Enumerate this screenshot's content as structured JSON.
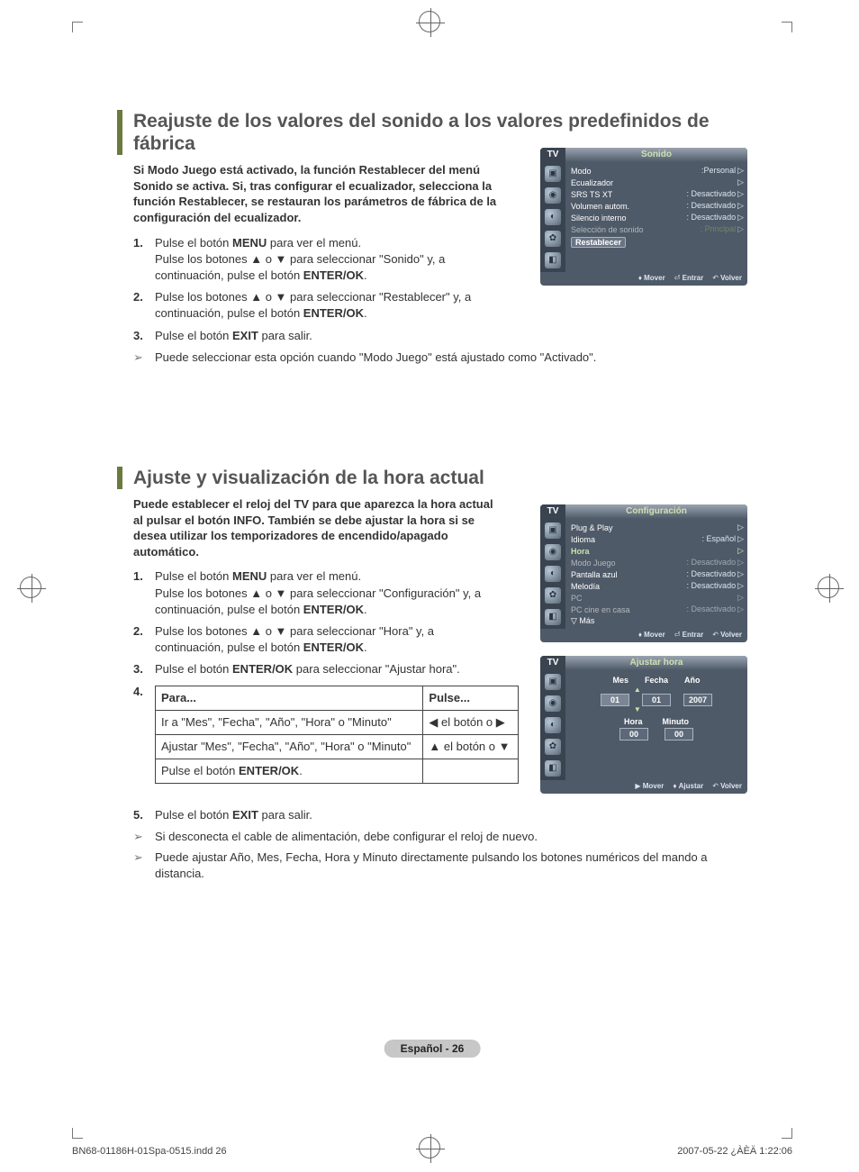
{
  "section1": {
    "title": "Reajuste de los valores del sonido a los valores predefinidos de fábrica",
    "intro": "Si Modo Juego está activado, la función Restablecer del menú Sonido se activa. Si, tras configurar el ecualizador, selecciona la función Restablecer, se restauran los parámetros de fábrica de la configuración del ecualizador.",
    "steps": [
      "Pulse el botón MENU para ver el menú.\nPulse los botones ▲ o ▼ para seleccionar \"Sonido\" y, a continuación, pulse el botón ENTER/OK.",
      "Pulse los botones ▲ o ▼ para seleccionar \"Restablecer\" y, a continuación, pulse el botón ENTER/OK.",
      "Pulse el botón EXIT para salir."
    ],
    "note": "Puede seleccionar esta opción cuando \"Modo Juego\" está ajustado como \"Activado\"."
  },
  "osd1": {
    "tv": "TV",
    "title": "Sonido",
    "rows": [
      {
        "lbl": "Modo",
        "val": ":Personal",
        "tri": "▷"
      },
      {
        "lbl": "Ecualizador",
        "val": "",
        "tri": "▷"
      },
      {
        "lbl": "SRS TS XT",
        "val": ": Desactivado",
        "tri": "▷"
      },
      {
        "lbl": "Volumen autom.",
        "val": ": Desactivado",
        "tri": "▷"
      },
      {
        "lbl": "Silencio interno",
        "val": ": Desactivado",
        "tri": "▷"
      },
      {
        "lbl": "Selección de sonido",
        "val": ": Principal",
        "tri": "▷",
        "dim": true
      }
    ],
    "pill": "Restablecer",
    "foot": {
      "move": "Mover",
      "enter": "Entrar",
      "back": "Volver"
    }
  },
  "section2": {
    "title": "Ajuste y visualización de la hora actual",
    "intro": "Puede establecer el reloj del TV para que aparezca la hora actual al pulsar el botón INFO. También se debe ajustar la hora si se desea utilizar los temporizadores de encendido/apagado automático.",
    "steps": [
      "Pulse el botón MENU para ver el menú.\nPulse los botones ▲ o ▼ para seleccionar \"Configuración\" y, a continuación, pulse el botón ENTER/OK.",
      "Pulse los botones ▲ o ▼ para seleccionar \"Hora\" y, a continuación, pulse el botón ENTER/OK.",
      "Pulse el botón ENTER/OK para seleccionar \"Ajustar hora\"."
    ],
    "step4": "4.",
    "table": {
      "h1": "Para...",
      "h2": "Pulse...",
      "rows": [
        {
          "a": "Ir a \"Mes\", \"Fecha\", \"Año\", \"Hora\" o \"Minuto\"",
          "b": "◀ el botón  o ▶"
        },
        {
          "a": "Ajustar \"Mes\", \"Fecha\", \"Año\", \"Hora\" o \"Minuto\"",
          "b": "▲ el botón  o ▼"
        },
        {
          "a": "Pulse el botón ENTER/OK.",
          "b": ""
        }
      ]
    },
    "step5": "Pulse el botón EXIT para salir.",
    "note1": "Si desconecta el cable de alimentación, debe configurar el reloj de nuevo.",
    "note2": "Puede ajustar Año, Mes, Fecha, Hora y Minuto directamente pulsando los botones numéricos del mando a distancia."
  },
  "osd2": {
    "tv": "TV",
    "title": "Configuración",
    "rows": [
      {
        "lbl": "Plug & Play",
        "val": "",
        "tri": "▷"
      },
      {
        "lbl": "Idioma",
        "val": ": Español",
        "tri": "▷"
      },
      {
        "lbl": "Hora",
        "val": "",
        "tri": "▷",
        "sel": true
      },
      {
        "lbl": "Modo Juego",
        "val": ": Desactivado",
        "tri": "▷",
        "dim": true
      },
      {
        "lbl": "Pantalla azul",
        "val": ": Desactivado",
        "tri": "▷"
      },
      {
        "lbl": "Melodía",
        "val": ": Desactivado",
        "tri": "▷"
      },
      {
        "lbl": "PC",
        "val": "",
        "tri": "▷",
        "dim": true
      },
      {
        "lbl": "PC cine en casa",
        "val": ": Desactivado",
        "tri": "▷",
        "dim": true
      },
      {
        "lbl": "▽ Más",
        "val": "",
        "tri": ""
      }
    ],
    "foot": {
      "move": "Mover",
      "enter": "Entrar",
      "back": "Volver"
    }
  },
  "osd3": {
    "tv": "TV",
    "title": "Ajustar hora",
    "labels1": {
      "mes": "Mes",
      "fecha": "Fecha",
      "ano": "Año"
    },
    "vals1": {
      "mes": "01",
      "fecha": "01",
      "ano": "2007"
    },
    "labels2": {
      "hora": "Hora",
      "minuto": "Minuto"
    },
    "vals2": {
      "hora": "00",
      "minuto": "00"
    },
    "foot": {
      "move": "Mover",
      "adjust": "Ajustar",
      "back": "Volver"
    }
  },
  "footer": {
    "page": "Español - 26",
    "file": "BN68-01186H-01Spa-0515.indd   26",
    "time": "2007-05-22   ¿ÀÈÄ 1:22:06"
  }
}
